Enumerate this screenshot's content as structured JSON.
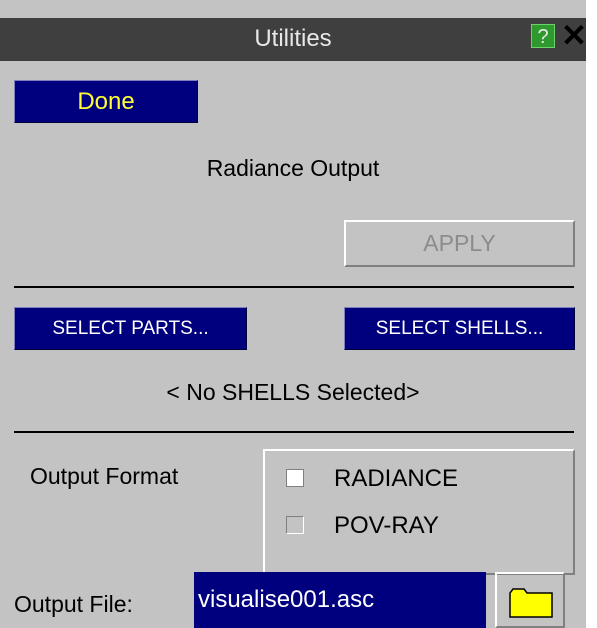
{
  "window": {
    "title": "Utilities",
    "help_label": "?",
    "close_label": "✕"
  },
  "toolbar": {
    "done_label": "Done"
  },
  "section": {
    "heading": "Radiance Output",
    "apply_label": "APPLY"
  },
  "selection": {
    "parts_label": "SELECT PARTS...",
    "shells_label": "SELECT SHELLS...",
    "status": "< No SHELLS Selected>"
  },
  "output_format": {
    "label": "Output Format",
    "options": [
      {
        "label": "RADIANCE",
        "selected": true
      },
      {
        "label": "POV-RAY",
        "selected": false
      }
    ]
  },
  "output_file": {
    "label": "Output File:",
    "value": "visualise001.asc",
    "folder_icon": "folder-icon"
  },
  "colors": {
    "panel": "#c3c3c3",
    "title_bar": "#3f3f3f",
    "button_blue": "#00007f",
    "done_text": "#ffff33",
    "help_green": "#2e9a2e"
  }
}
